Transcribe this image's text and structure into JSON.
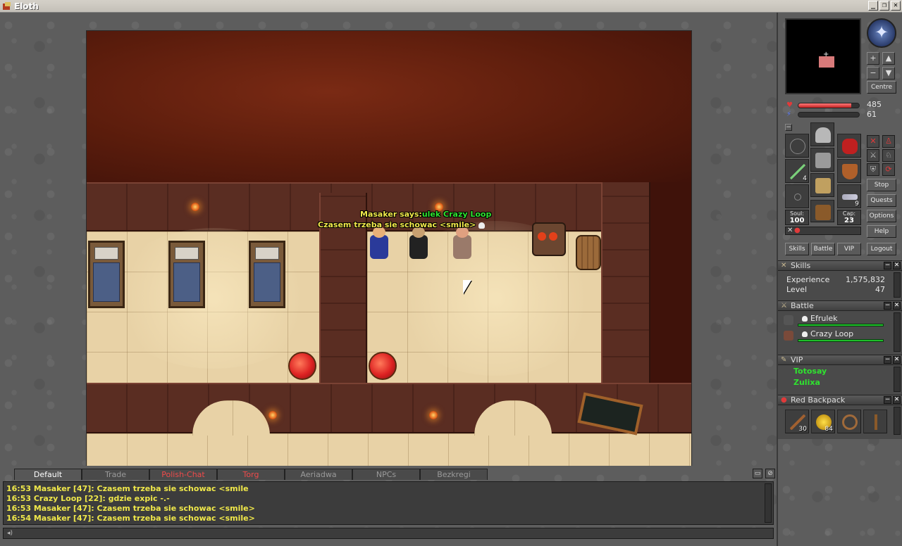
{
  "window": {
    "title": "Eloth",
    "minimize": "_",
    "restore": "❐",
    "close": "✕"
  },
  "game": {
    "speaker_line": "Masaker says:",
    "speaker_names": "ulek Crazy Loop",
    "speech_text": "Czasem trzeba sie schowac <smile>"
  },
  "status": {
    "health": "485",
    "mana": "61",
    "health_fraction": 0.87,
    "mana_fraction": 0.0
  },
  "minimap_buttons": {
    "zoom_in": "+",
    "zoom_out": "−",
    "floor_up": "▲",
    "floor_down": "▼",
    "centre": "Centre"
  },
  "inventory": {
    "soul_label": "Soul:",
    "soul_value": "100",
    "cap_label": "Cap:",
    "cap_value": "23",
    "arrows_count": "4",
    "ammo_count": "9"
  },
  "side_buttons": {
    "stop": "Stop",
    "quests": "Quests",
    "options": "Options",
    "help": "Help",
    "logout": "Logout",
    "skills": "Skills",
    "battle": "Battle",
    "vip": "VIP"
  },
  "skills_window": {
    "title": "Skills",
    "rows": [
      {
        "label": "Experience",
        "value": "1,575,832"
      },
      {
        "label": "Level",
        "value": "47"
      }
    ]
  },
  "battle_window": {
    "title": "Battle",
    "entries": [
      {
        "name": "Efrulek",
        "hp_fraction": 1.0
      },
      {
        "name": "Crazy Loop",
        "hp_fraction": 1.0
      }
    ]
  },
  "vip_window": {
    "title": "VIP",
    "entries": [
      "Totosay",
      "Zulixa"
    ]
  },
  "backpack_window": {
    "title": "Red Backpack",
    "items": [
      {
        "icon": "spear-icon",
        "count": "30"
      },
      {
        "icon": "gold-coins-icon",
        "count": "84"
      },
      {
        "icon": "rope-icon",
        "count": ""
      },
      {
        "icon": "shovel-icon",
        "count": ""
      }
    ]
  },
  "console": {
    "tabs": [
      "Default",
      "Trade",
      "Polish-Chat",
      "Torg",
      "Aeriadwa",
      "NPCs",
      "Bezkregi"
    ],
    "lines": [
      "16:53 Masaker [47]: Czasem trzeba sie schowac <smile",
      "16:53 Crazy Loop [22]: gdzie expic -.-",
      "16:53 Masaker [47]: Czasem trzeba sie schowac <smile>",
      "16:54 Masaker [47]: Czasem trzeba sie schowac <smile>"
    ],
    "input_value": ""
  },
  "colors": {
    "chat_yellow": "#f0e84a",
    "vip_online": "#2fe32f",
    "channel_red": "#f04a4a",
    "health_red": "#e03a3a",
    "mana_blue": "#3a5ad8"
  }
}
